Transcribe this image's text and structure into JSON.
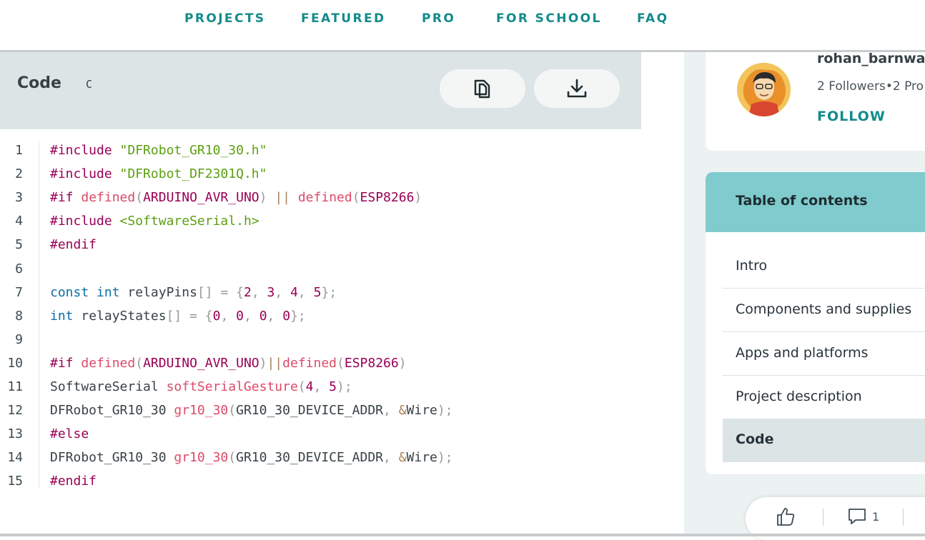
{
  "nav": {
    "items": [
      "PROJECTS",
      "FEATURED",
      "PRO",
      "FOR SCHOOL",
      "FAQ"
    ]
  },
  "code_panel": {
    "title": "Code",
    "language": "C",
    "copy_icon": "copy-icon",
    "download_icon": "download-icon",
    "line_numbers": [
      "1",
      "2",
      "3",
      "4",
      "5",
      "6",
      "7",
      "8",
      "9",
      "10",
      "11",
      "12",
      "13",
      "14",
      "15"
    ],
    "lines": [
      "#include \"DFRobot_GR10_30.h\"",
      "#include \"DFRobot_DF2301Q.h\"",
      "#if defined(ARDUINO_AVR_UNO) || defined(ESP8266)",
      "#include <SoftwareSerial.h>",
      "#endif",
      "",
      "const int relayPins[] = {2, 3, 4, 5};",
      "int relayStates[] = {0, 0, 0, 0};",
      "",
      "#if defined(ARDUINO_AVR_UNO)||defined(ESP8266)",
      "SoftwareSerial softSerialGesture(4, 5);",
      "DFRobot_GR10_30 gr10_30(GR10_30_DEVICE_ADDR, &Wire);",
      "#else",
      "DFRobot_GR10_30 gr10_30(GR10_30_DEVICE_ADDR, &Wire);",
      "#endif"
    ]
  },
  "author": {
    "name": "rohan_barnwa",
    "stats": "2 Followers•2 Pro",
    "follow_label": "FOLLOW",
    "avatar_icon": "avatar-illustration"
  },
  "toc": {
    "title": "Table of contents",
    "items": [
      "Intro",
      "Components and supplies",
      "Apps and platforms",
      "Project description",
      "Code"
    ],
    "active_index": 4
  },
  "actions": {
    "like_icon": "thumbs-up-icon",
    "comment_icon": "comment-icon",
    "comment_count": "1"
  },
  "colors": {
    "accent": "#138b8b",
    "toc_header": "#7fcbcd",
    "code_header": "#dce4e6"
  }
}
